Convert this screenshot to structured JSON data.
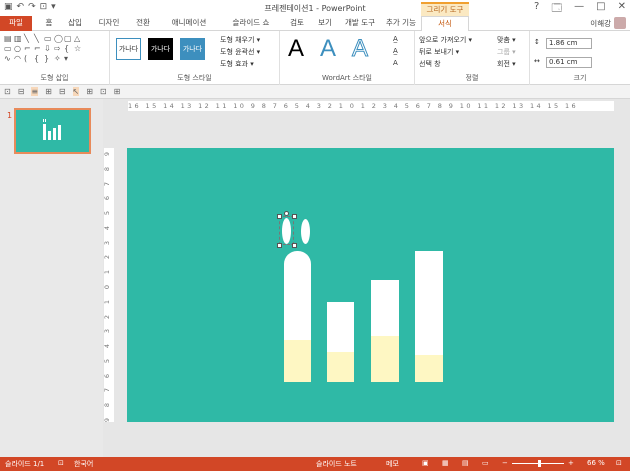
{
  "window": {
    "title": "프레젠테이션1 - PowerPoint",
    "context_tab_header": "그리기 도구",
    "help": "?",
    "controls": [
      "🗔",
      "—",
      "□",
      "✕"
    ]
  },
  "qat": [
    "▣",
    "↶",
    "↷",
    "⊡",
    "▾"
  ],
  "tabs": [
    {
      "label": "파일"
    },
    {
      "label": "홈"
    },
    {
      "label": "삽입"
    },
    {
      "label": "디자인"
    },
    {
      "label": "전환"
    },
    {
      "label": "애니메이션"
    },
    {
      "label": "슬라이드 쇼"
    },
    {
      "label": "검토"
    },
    {
      "label": "보기"
    },
    {
      "label": "개발 도구"
    },
    {
      "label": "추가 기능"
    },
    {
      "label": "서식"
    }
  ],
  "user": {
    "name": "이해강"
  },
  "ribbon": {
    "groups": {
      "insert_shapes": "도형 삽입",
      "shape_styles": "도형 스타일",
      "wordart_styles": "WordArt 스타일",
      "arrange": "정렬",
      "size": "크기"
    },
    "style_samples": [
      "가나다",
      "가나다",
      "가나다"
    ],
    "shape_commands": [
      "도형 채우기 ▾",
      "도형 윤곽선 ▾",
      "도형 효과 ▾"
    ],
    "wordart_letter": "A",
    "arrange_commands": [
      "앞으로 가져오기 ▾",
      "뒤로 보내기 ▾",
      "선택 창",
      "맞춤 ▾",
      "그룹 ▾",
      "회전 ▾"
    ],
    "height": "1.86 cm",
    "width": "0.61 cm"
  },
  "toolbar2_icons": [
    "⊡",
    "⊟",
    "≡",
    "⊞",
    "⊟",
    "↖",
    "⊞",
    "⊡",
    "⊞"
  ],
  "slides": {
    "number": "1"
  },
  "rulers": {
    "horizontal": "16 15 14 13 12 11 10 9 8 7 6 5 4 3 2 1 0 1 2 3 4 5 6 7 8 9 10 11 12 13 14 15 16",
    "vertical": [
      "9",
      "8",
      "7",
      "6",
      "5",
      "4",
      "3",
      "2",
      "1",
      "0",
      "1",
      "2",
      "3",
      "4",
      "5",
      "6",
      "7",
      "8",
      "9"
    ]
  },
  "chart_data": {
    "type": "bar",
    "bars": [
      {
        "level": 0.32
      },
      {
        "level": 0.37
      },
      {
        "level": 0.45
      },
      {
        "level": 0.21
      }
    ]
  },
  "statusbar": {
    "slide": "슬라이드 1/1",
    "language": "한국어",
    "notes": "슬라이드 노트",
    "comments": "메모",
    "zoom": "66 %"
  },
  "colors": {
    "accent": "#d24726",
    "slide_bg": "#2fb9a6",
    "bar_fill": "#fef7c3"
  }
}
